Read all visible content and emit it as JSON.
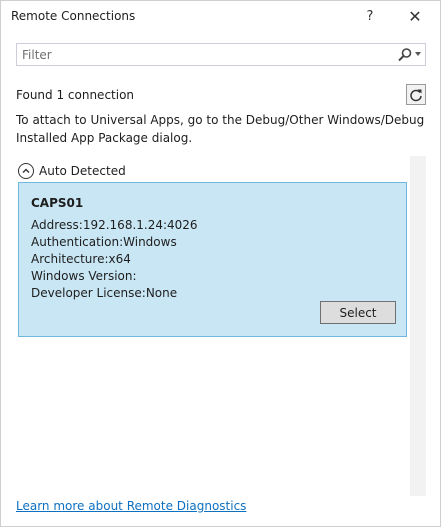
{
  "window": {
    "title": "Remote Connections",
    "help_label": "?",
    "close_label": "✕"
  },
  "search": {
    "placeholder": "Filter",
    "value": ""
  },
  "status": {
    "found_text": "Found 1 connection",
    "info_text": "To attach to Universal Apps, go to the Debug/Other Windows/Debug Installed App Package dialog."
  },
  "group": {
    "label": "Auto Detected"
  },
  "connection": {
    "name": "CAPS01",
    "address": "Address:192.168.1.24:4026",
    "authentication": "Authentication:Windows",
    "architecture": "Architecture:x64",
    "windows_version": "Windows Version:",
    "developer_license": "Developer License:None",
    "select_label": "Select"
  },
  "footer": {
    "learn_more": "Learn more about Remote Diagnostics"
  },
  "colors": {
    "card_bg": "#c9e6f4",
    "card_border": "#6fb7dd",
    "link": "#0e70c0"
  }
}
